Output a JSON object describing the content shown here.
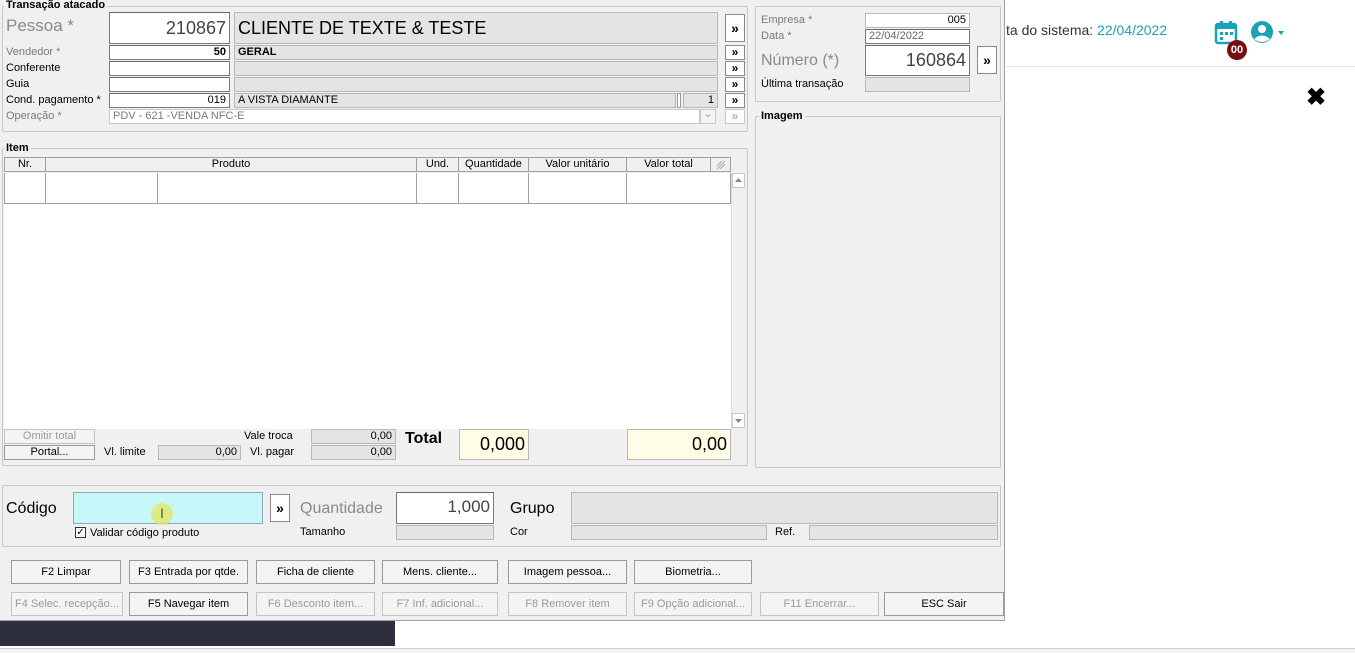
{
  "header": {
    "date_label": "ta do sistema:",
    "date_value": "22/04/2022",
    "notification_count": "00",
    "accent": "#1aa3b5"
  },
  "close_glyph": "✖",
  "form": {
    "title": "Transação atacado",
    "pessoa": {
      "label": "Pessoa *",
      "code": "210867",
      "name": "CLIENTE DE TEXTE & TESTE"
    },
    "vendedor": {
      "label": "Vendedor *",
      "code": "50",
      "name": "GERAL"
    },
    "conferente": {
      "label": "Conferente",
      "code": "",
      "name": ""
    },
    "guia": {
      "label": "Guia",
      "code": "",
      "name": ""
    },
    "cond_pagamento": {
      "label": "Cond. pagamento *",
      "code": "019",
      "name": "A VISTA DIAMANTE",
      "parcelas": "1"
    },
    "operacao": {
      "label": "Operação *",
      "value": "PDV - 621 -VENDA NFC-E"
    },
    "more_glyph": "»",
    "dropdown_glyph": "⌄",
    "empresa": {
      "label": "Empresa *",
      "value": "005"
    },
    "data": {
      "label": "Data *",
      "value": "22/04/2022"
    },
    "numero": {
      "label": "Número (*)",
      "value": "160864"
    },
    "ultima_transacao": {
      "label": "Última transação",
      "value": ""
    },
    "imagem_title": "Imagem"
  },
  "items": {
    "title": "Item",
    "columns": [
      "Nr.",
      "Produto",
      "Und.",
      "Quantidade",
      "Valor unitário",
      "Valor total"
    ],
    "rows": []
  },
  "totals": {
    "omitir_total": "Omitir total",
    "portal": "Portal...",
    "vl_limite_label": "Vl. limite",
    "vl_limite_value": "0,00",
    "vale_troca_label": "Vale troca",
    "vale_troca_value": "0,00",
    "vl_pagar_label": "Vl. pagar",
    "vl_pagar_value": "0,00",
    "total_label": "Total",
    "total_qty": "0,000",
    "total_value": "0,00"
  },
  "product_entry": {
    "codigo_label": "Código",
    "codigo_value": "",
    "validar_label": "Validar código produto",
    "validar_checked": true,
    "quantidade_label": "Quantidade",
    "quantidade_value": "1,000",
    "tamanho_label": "Tamanho",
    "grupo_label": "Grupo",
    "cor_label": "Cor",
    "ref_label": "Ref."
  },
  "function_keys": {
    "row1": [
      "F2 Limpar",
      "F3 Entrada por qtde.",
      "Ficha de cliente",
      "Mens. cliente...",
      "Imagem pessoa...",
      "Biometria..."
    ],
    "row2": [
      "F4 Selec. recepção...",
      "F5 Navegar item",
      "F6 Desconto item...",
      "F7 Inf. adicional...",
      "F8 Remover item",
      "F9 Opção adicional...",
      "F11 Encerrar...",
      "ESC Sair"
    ]
  },
  "colors": {
    "window_bg": "#f0f0f0",
    "codigo_field": "#c8f7fa",
    "total_field": "#fffde6",
    "taskbar": "#2d2f3e"
  }
}
